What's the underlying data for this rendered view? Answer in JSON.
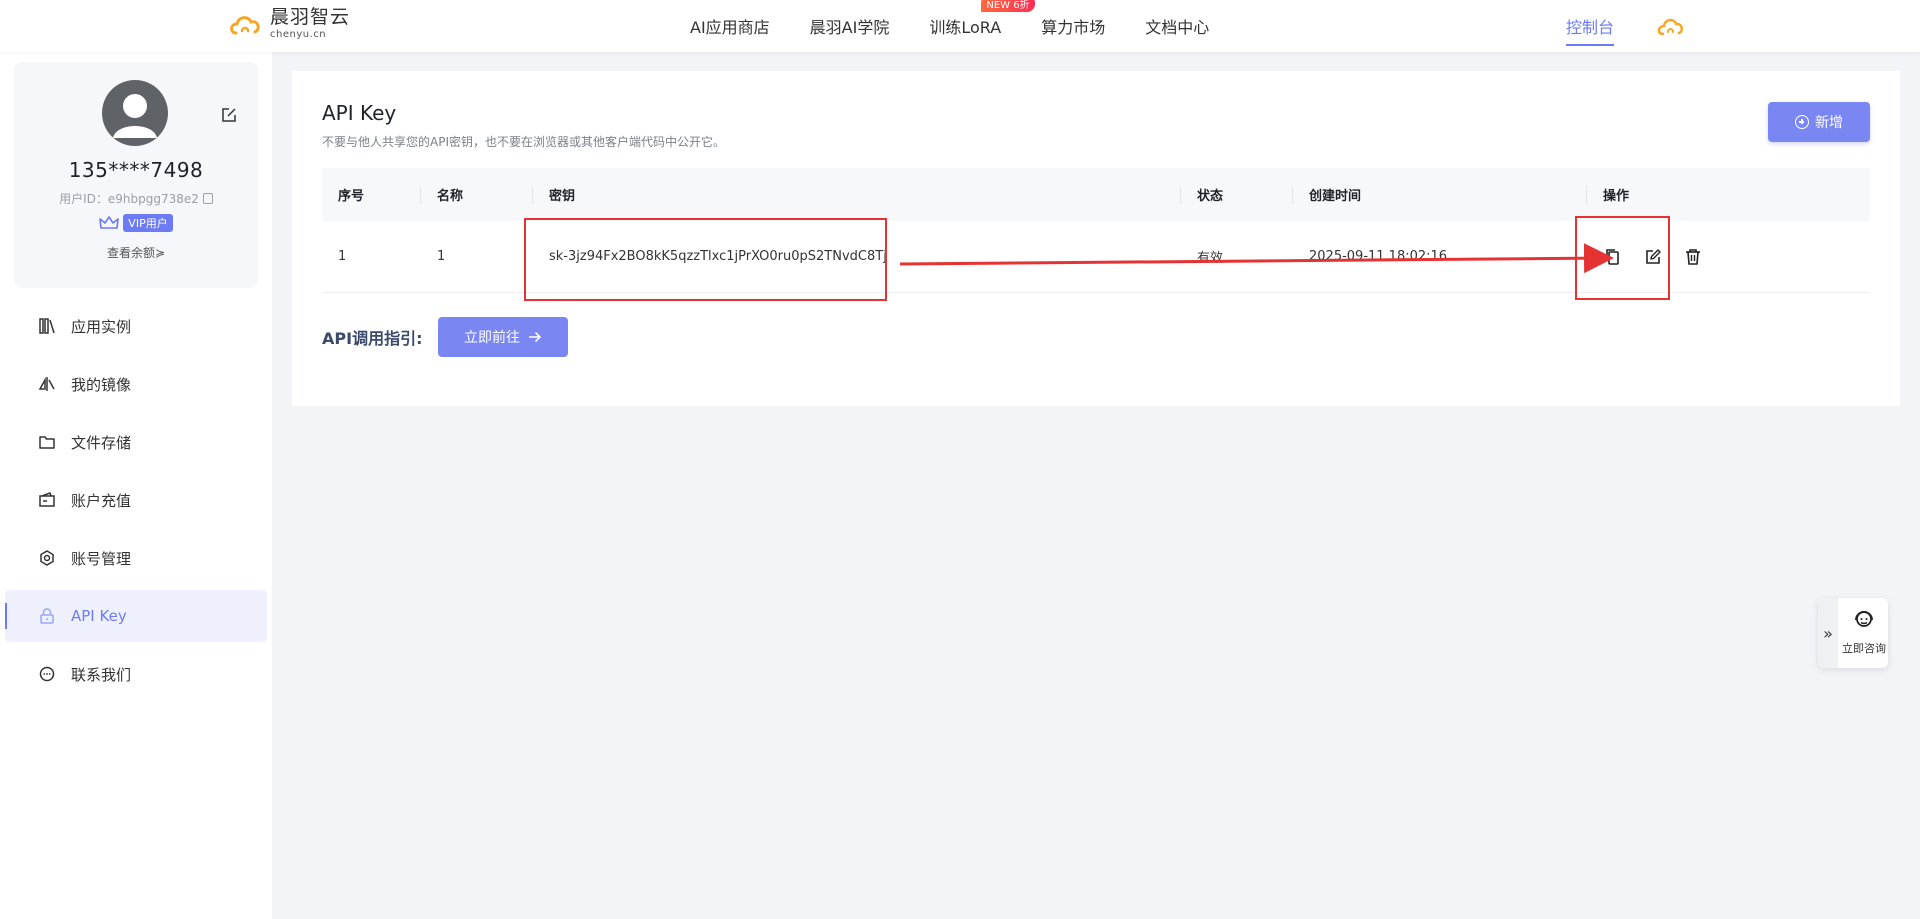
{
  "brand": {
    "name": "晨羽智云",
    "domain": "chenyu.cn",
    "accent_color": "#6c7bf3",
    "logo_color": "#f5a623"
  },
  "nav": {
    "links": [
      "AI应用商店",
      "晨羽AI学院",
      "训练LoRA",
      "算力市场",
      "文档中心"
    ],
    "lora_badge": "NEW 6折",
    "console": "控制台"
  },
  "profile": {
    "phone": "135****7498",
    "user_id": "用户ID：e9hbpgg738e2",
    "vip": "VIP用户",
    "balance_link": "查看余额"
  },
  "menu": [
    {
      "label": "应用实例",
      "icon": "app-instance-icon"
    },
    {
      "label": "我的镜像",
      "icon": "mirror-image-icon"
    },
    {
      "label": "文件存储",
      "icon": "folder-icon"
    },
    {
      "label": "账户充值",
      "icon": "wallet-icon"
    },
    {
      "label": "账号管理",
      "icon": "settings-icon"
    },
    {
      "label": "API Key",
      "icon": "lock-icon",
      "active": true
    },
    {
      "label": "联系我们",
      "icon": "chat-icon"
    }
  ],
  "page": {
    "title": "API Key",
    "subtitle": "不要与他人共享您的API密钥，也不要在浏览器或其他客户端代码中公开它。",
    "add_button": "新增"
  },
  "table": {
    "headers": [
      "序号",
      "名称",
      "密钥",
      "状态",
      "创建时间",
      "操作"
    ],
    "rows": [
      {
        "index": "1",
        "name": "1",
        "key": "sk-3jz94Fx2BO8kK5qzzTlxc1jPrXO0ru0pS2TNvdC8Tj",
        "status": "有效",
        "created": "2025-09-11 18:02:16"
      }
    ],
    "actions": [
      "copy-icon",
      "edit-icon",
      "delete-icon"
    ]
  },
  "guide": {
    "label": "API调用指引:",
    "button": "立即前往"
  },
  "float": {
    "label": "立即咨询"
  },
  "annotation_color": "#e53333"
}
